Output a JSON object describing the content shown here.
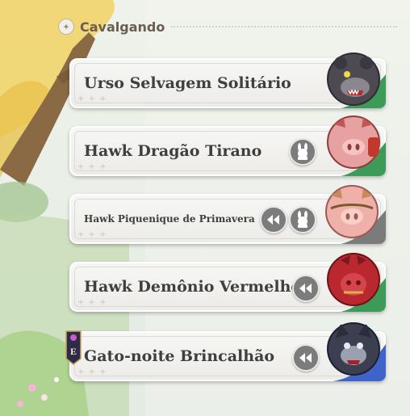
{
  "section": {
    "title": "Cavalgando",
    "icon": "compass-star-icon"
  },
  "mounts": [
    {
      "name": "Urso Selvagem Solitário",
      "portrait": "wild-bear-icon",
      "accent": "#3e9a58",
      "actions": []
    },
    {
      "name": "Hawk Dragão Tirano",
      "portrait": "pig-tyrant-icon",
      "accent": "#3e9a58",
      "actions": [
        "bunny-mount-icon"
      ]
    },
    {
      "name": "Hawk Piquenique de Primavera",
      "portrait": "pig-picnic-icon",
      "accent": "#7b7b7b",
      "actions": [
        "rewind-icon",
        "bunny-mount-icon"
      ]
    },
    {
      "name": "Hawk Demônio Vermelho",
      "portrait": "red-demon-icon",
      "accent": "#3e9a58",
      "actions": [
        "rewind-icon"
      ]
    },
    {
      "name": "Gato-noite Brincalhão",
      "portrait": "night-cat-icon",
      "accent": "#3f63c8",
      "actions": [
        "rewind-icon"
      ],
      "badge": "E"
    }
  ]
}
